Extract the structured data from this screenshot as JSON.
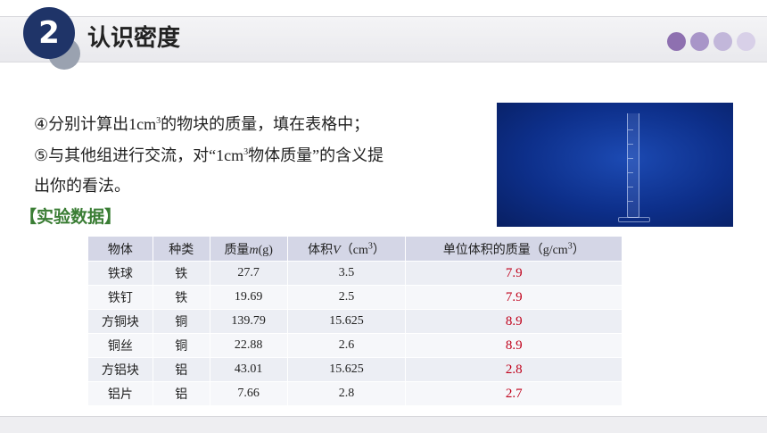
{
  "header": {
    "section_number": "2",
    "section_title": "认识密度"
  },
  "decor": {
    "dot_colors": [
      "#8e70b0",
      "#a895c8",
      "#c2b7da",
      "#d8d0e8"
    ]
  },
  "content": {
    "line1_pre": "④分别计算出",
    "line1_unit": "1cm",
    "line1_sup": "3",
    "line1_post": "的物块的质量，填在表格中；",
    "line2_pre": "⑤与其他组进行交流，对",
    "line2_quote": "“1cm",
    "line2_sup": "3",
    "line2_mid": "物体质量",
    "line2_close": "”",
    "line2_post": "的含义提",
    "line3": "出你的看法。"
  },
  "data_heading": "【实验数据】",
  "table": {
    "headers": {
      "object": "物体",
      "kind": "种类",
      "mass_pre": "质量",
      "mass_var": "m",
      "mass_unit": "(g)",
      "volume_pre": "体积",
      "volume_var": "V",
      "volume_open": "（",
      "volume_unit": "cm",
      "volume_sup": "3",
      "volume_close": "）",
      "unit_mass_pre": "单位体积的质量（",
      "unit_mass_unit": "g/cm",
      "unit_mass_sup": "3",
      "unit_mass_close": "）"
    },
    "rows": [
      {
        "object": "铁球",
        "kind": "铁",
        "mass": "27.7",
        "volume": "3.5",
        "unit_mass": "7.9"
      },
      {
        "object": "铁钉",
        "kind": "铁",
        "mass": "19.69",
        "volume": "2.5",
        "unit_mass": "7.9"
      },
      {
        "object": "方铜块",
        "kind": "铜",
        "mass": "139.79",
        "volume": "15.625",
        "unit_mass": "8.9"
      },
      {
        "object": "铜丝",
        "kind": "铜",
        "mass": "22.88",
        "volume": "2.6",
        "unit_mass": "8.9"
      },
      {
        "object": "方铝块",
        "kind": "铝",
        "mass": "43.01",
        "volume": "15.625",
        "unit_mass": "2.8"
      },
      {
        "object": "铝片",
        "kind": "铝",
        "mass": "7.66",
        "volume": "2.8",
        "unit_mass": "2.7"
      }
    ]
  }
}
